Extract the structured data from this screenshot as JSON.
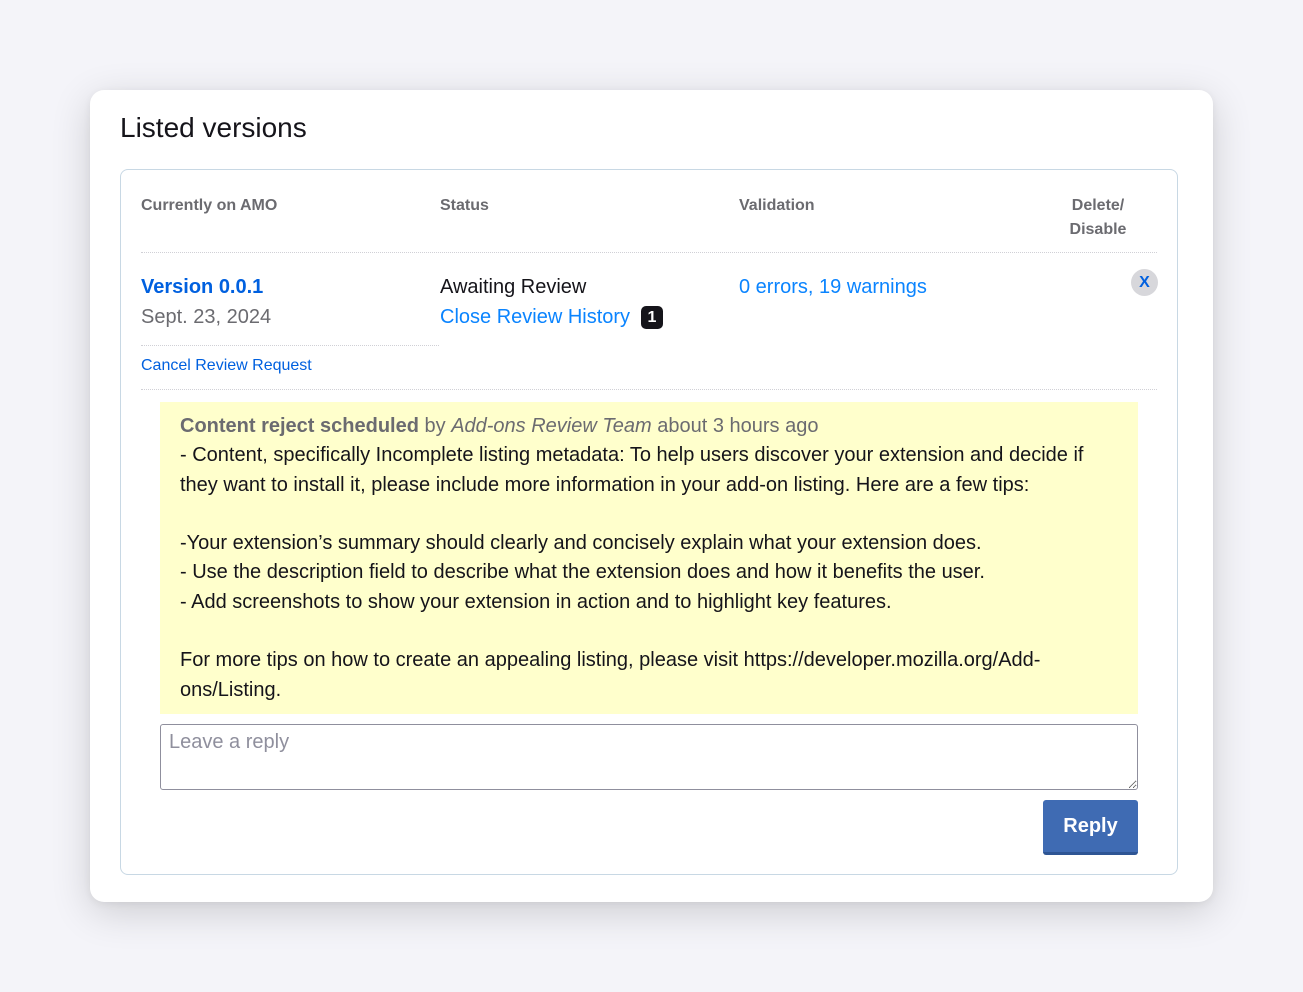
{
  "page": {
    "title": "Listed versions"
  },
  "table": {
    "headers": {
      "currently_on_amo": "Currently on AMO",
      "status": "Status",
      "validation": "Validation",
      "delete_line1": "Delete/",
      "delete_line2": "Disable"
    }
  },
  "version": {
    "label": "Version 0.0.1",
    "date": "Sept. 23, 2024",
    "status": "Awaiting Review",
    "history_link": "Close Review History",
    "history_count": "1",
    "validation": "0 errors, 19 warnings",
    "delete_symbol": "X",
    "cancel_link": "Cancel Review Request"
  },
  "review": {
    "action": "Content reject scheduled",
    "by": "by",
    "author": "Add-ons Review Team",
    "time": "about 3 hours ago",
    "comment_lines": [
      "- Content, specifically Incomplete listing metadata: To help users discover your extension and decide if they want to install it, please include more information in your add-on listing. Here are a few tips:",
      "",
      "-Your extension’s summary should clearly and concisely explain what your extension does.",
      "- Use the description field to describe what the extension does and how it benefits the user.",
      "- Add screenshots to show your extension in action and to highlight key features.",
      "",
      "For more tips on how to create an appealing listing, please visit https://developer.mozilla.org/Add-ons/Listing."
    ]
  },
  "reply": {
    "placeholder": "Leave a reply",
    "value": "",
    "button_label": "Reply"
  },
  "colors": {
    "link": "#0a84ff",
    "link_dark": "#0060df",
    "review_bg": "#ffffcc",
    "reply_button": "#3f6bb3"
  }
}
